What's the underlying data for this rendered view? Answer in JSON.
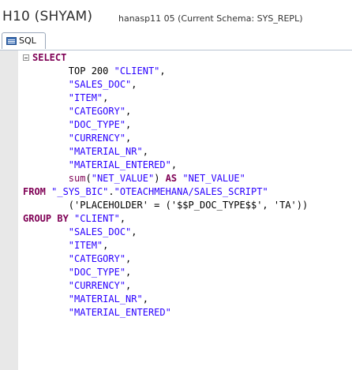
{
  "header": {
    "connection_title": "H10 (SHYAM)",
    "connection_info": "hanasp11 05 (Current Schema: SYS_REPL)"
  },
  "tabs": [
    {
      "label": "SQL",
      "icon": "sql-icon"
    }
  ],
  "editor": {
    "lines": [
      [
        {
          "t": "kw",
          "v": "SELECT"
        }
      ],
      [
        {
          "t": "plain",
          "v": "        TOP 200 "
        },
        {
          "t": "str",
          "v": "\"CLIENT\""
        },
        {
          "t": "plain",
          "v": ","
        }
      ],
      [
        {
          "t": "plain",
          "v": "        "
        },
        {
          "t": "str",
          "v": "\"SALES_DOC\""
        },
        {
          "t": "plain",
          "v": ","
        }
      ],
      [
        {
          "t": "plain",
          "v": "        "
        },
        {
          "t": "str",
          "v": "\"ITEM\""
        },
        {
          "t": "plain",
          "v": ","
        }
      ],
      [
        {
          "t": "plain",
          "v": "        "
        },
        {
          "t": "str",
          "v": "\"CATEGORY\""
        },
        {
          "t": "plain",
          "v": ","
        }
      ],
      [
        {
          "t": "plain",
          "v": "        "
        },
        {
          "t": "str",
          "v": "\"DOC_TYPE\""
        },
        {
          "t": "plain",
          "v": ","
        }
      ],
      [
        {
          "t": "plain",
          "v": "        "
        },
        {
          "t": "str",
          "v": "\"CURRENCY\""
        },
        {
          "t": "plain",
          "v": ","
        }
      ],
      [
        {
          "t": "plain",
          "v": "        "
        },
        {
          "t": "str",
          "v": "\"MATERIAL_NR\""
        },
        {
          "t": "plain",
          "v": ","
        }
      ],
      [
        {
          "t": "plain",
          "v": "        "
        },
        {
          "t": "str",
          "v": "\"MATERIAL_ENTERED\""
        },
        {
          "t": "plain",
          "v": ","
        }
      ],
      [
        {
          "t": "plain",
          "v": "        "
        },
        {
          "t": "fn",
          "v": "sum"
        },
        {
          "t": "plain",
          "v": "("
        },
        {
          "t": "str",
          "v": "\"NET_VALUE\""
        },
        {
          "t": "plain",
          "v": ") "
        },
        {
          "t": "kw",
          "v": "AS"
        },
        {
          "t": "plain",
          "v": " "
        },
        {
          "t": "str",
          "v": "\"NET_VALUE\""
        }
      ],
      [
        {
          "t": "kw",
          "v": "FROM"
        },
        {
          "t": "plain",
          "v": " "
        },
        {
          "t": "str",
          "v": "\"_SYS_BIC\""
        },
        {
          "t": "plain",
          "v": "."
        },
        {
          "t": "str",
          "v": "\"OTEACHMEHANA/SALES_SCRIPT\""
        }
      ],
      [
        {
          "t": "plain",
          "v": "        ('PLACEHOLDER' = ('$$P_DOC_TYPE$$', 'TA'))"
        }
      ],
      [
        {
          "t": "kw",
          "v": "GROUP BY"
        },
        {
          "t": "plain",
          "v": " "
        },
        {
          "t": "str",
          "v": "\"CLIENT\""
        },
        {
          "t": "plain",
          "v": ","
        }
      ],
      [
        {
          "t": "plain",
          "v": "        "
        },
        {
          "t": "str",
          "v": "\"SALES_DOC\""
        },
        {
          "t": "plain",
          "v": ","
        }
      ],
      [
        {
          "t": "plain",
          "v": "        "
        },
        {
          "t": "str",
          "v": "\"ITEM\""
        },
        {
          "t": "plain",
          "v": ","
        }
      ],
      [
        {
          "t": "plain",
          "v": "        "
        },
        {
          "t": "str",
          "v": "\"CATEGORY\""
        },
        {
          "t": "plain",
          "v": ","
        }
      ],
      [
        {
          "t": "plain",
          "v": "        "
        },
        {
          "t": "str",
          "v": "\"DOC_TYPE\""
        },
        {
          "t": "plain",
          "v": ","
        }
      ],
      [
        {
          "t": "plain",
          "v": "        "
        },
        {
          "t": "str",
          "v": "\"CURRENCY\""
        },
        {
          "t": "plain",
          "v": ","
        }
      ],
      [
        {
          "t": "plain",
          "v": "        "
        },
        {
          "t": "str",
          "v": "\"MATERIAL_NR\""
        },
        {
          "t": "plain",
          "v": ","
        }
      ],
      [
        {
          "t": "plain",
          "v": "        "
        },
        {
          "t": "str",
          "v": "\"MATERIAL_ENTERED\""
        }
      ]
    ]
  },
  "colors": {
    "keyword": "#7f0055",
    "string": "#2a00ff",
    "gutter": "#e8e8e8"
  }
}
